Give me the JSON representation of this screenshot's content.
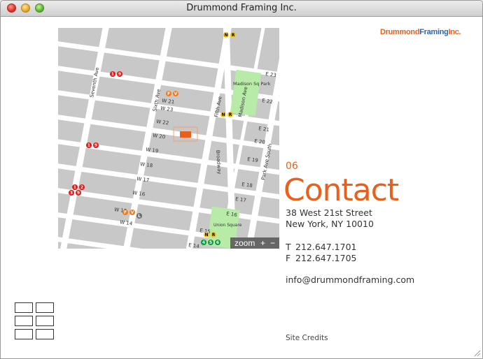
{
  "window": {
    "title": "Drummond Framing Inc."
  },
  "logo": {
    "part1": "Drummond",
    "part2": "Framing",
    "part3": "Inc."
  },
  "map": {
    "zoom_label": "zoom",
    "zoom_in": "+",
    "zoom_out": "−",
    "street_labels": {
      "seventh": "Seventh Ave",
      "sixth": "Sixth Ave",
      "fifth": "Fifth Ave",
      "broadway": "Broadway",
      "madison": "Madison Ave",
      "park": "Park Ave South",
      "w23": "W 23",
      "w22": "W 22",
      "w21": "W 21",
      "w20": "W 20",
      "w19": "W 19",
      "w18": "W 18",
      "w17": "W 17",
      "w16": "W 16",
      "w15": "W 15",
      "w14": "W 14",
      "e23": "E 23",
      "e22": "E 22",
      "e21": "E 21",
      "e20": "E 20",
      "e19": "E 19",
      "e18": "E 18",
      "e17": "E 17",
      "e16": "E 16",
      "e15": "E 15",
      "e14": "E 14",
      "madison_park": "Madison Sq Park",
      "union_square": "Union Square"
    },
    "subway": {
      "nr_top_n": "N",
      "nr_top_r": "R",
      "nr_mid_n": "N",
      "nr_mid_r": "R",
      "nr_bot_n": "N",
      "nr_bot_r": "R",
      "s1a": "1",
      "s9a": "9",
      "s1b": "1",
      "s9b": "9",
      "s1c": "1",
      "s2c": "2",
      "s3c": "3",
      "s9c": "9",
      "fa": "F",
      "va": "V",
      "fb": "F",
      "vb": "V",
      "lb": "L",
      "g4": "4",
      "g5": "5",
      "g6": "6"
    }
  },
  "contact": {
    "number": "06",
    "heading": "Contact",
    "address_line1": "38 West 21st Street",
    "address_line2": "New York, NY 10010",
    "phone_label": "T",
    "phone": "212.647.1701",
    "fax_label": "F",
    "fax": "212.647.1705",
    "email": "info@drummondframing.com",
    "credits": "Site Credits"
  },
  "colors": {
    "accent": "#e8601c",
    "brand_blue": "#2b63b7",
    "park": "#b8eaa8",
    "red_line": "#e01818",
    "orange_line": "#f27a1a",
    "yellow_line": "#f5c518",
    "gray_line": "#6d6e71",
    "green_line": "#0a9a3c"
  }
}
